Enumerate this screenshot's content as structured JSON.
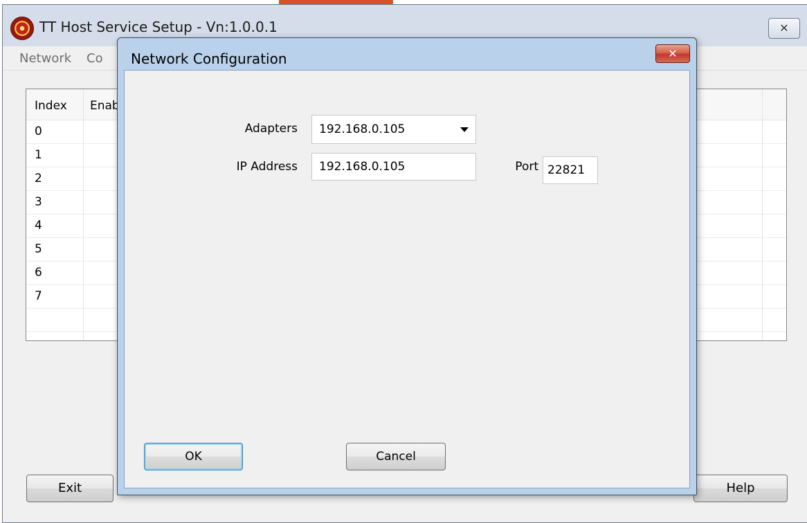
{
  "main_window": {
    "title": "TT Host Service Setup - Vn:1.0.0.1",
    "close_glyph": "✕",
    "menu": [
      "Network",
      "Co"
    ],
    "grid": {
      "columns": [
        "Index",
        "Enab"
      ],
      "rows": [
        "0",
        "1",
        "2",
        "3",
        "4",
        "5",
        "6",
        "7"
      ]
    },
    "buttons": {
      "exit": "Exit",
      "help": "Help"
    }
  },
  "dialog": {
    "title": "Network Configuration",
    "close_glyph": "✕",
    "adapters_label": "Adapters",
    "adapters_value": "192.168.0.105",
    "ip_label": "IP Address",
    "ip_value": "192.168.0.105",
    "port_label": "Port",
    "port_value": "22821",
    "ok_label": "OK",
    "cancel_label": "Cancel"
  },
  "colors": {
    "dialog_frame": "#b9d1ea",
    "close_button_red": "#c0392b",
    "default_button_glow": "#8fd3ee"
  },
  "icons": {
    "app": "antenna-badge-icon",
    "dropdown": "chevron-down-icon",
    "close": "close-icon"
  }
}
